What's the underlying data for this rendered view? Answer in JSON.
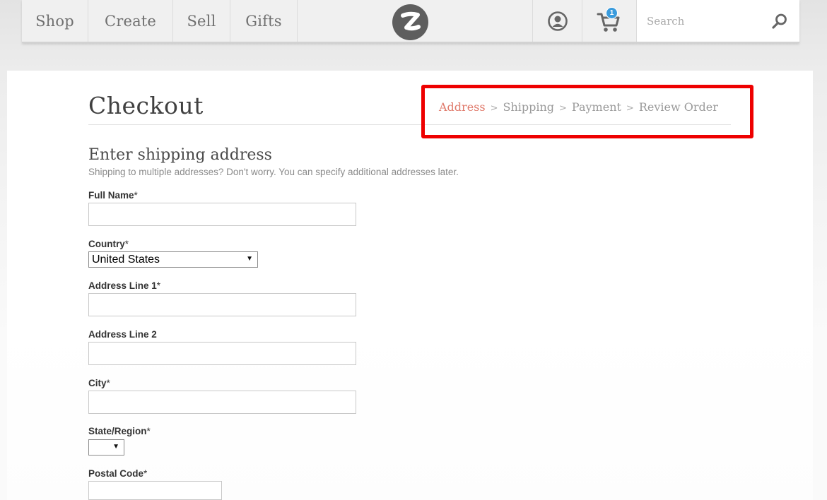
{
  "nav": {
    "items": [
      {
        "label": "Shop"
      },
      {
        "label": "Create"
      },
      {
        "label": "Sell"
      },
      {
        "label": "Gifts"
      }
    ],
    "cart_count": "1",
    "search_placeholder": "Search"
  },
  "checkout": {
    "title": "Checkout",
    "steps": {
      "address": "Address",
      "shipping": "Shipping",
      "payment": "Payment",
      "review": "Review Order",
      "separator": ">"
    },
    "highlight_color": "#ee0000",
    "active_step_color": "#e07a6b"
  },
  "form": {
    "heading": "Enter shipping address",
    "subheading": "Shipping to multiple addresses? Don't worry. You can specify additional addresses later.",
    "full_name_label": "Full Name",
    "country_label": "Country",
    "country_value": "United States",
    "address1_label": "Address Line 1",
    "address2_label": "Address Line 2",
    "city_label": "City",
    "state_label": "State/Region",
    "state_value": "",
    "postal_label": "Postal Code",
    "required_mark": "*"
  }
}
